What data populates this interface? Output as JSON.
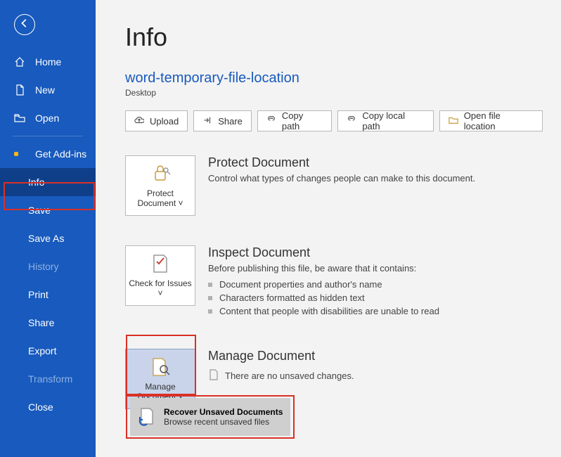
{
  "sidebar": {
    "items": [
      {
        "label": "Home"
      },
      {
        "label": "New"
      },
      {
        "label": "Open"
      },
      {
        "label": "Get Add-ins"
      },
      {
        "label": "Info"
      },
      {
        "label": "Save"
      },
      {
        "label": "Save As"
      },
      {
        "label": "History"
      },
      {
        "label": "Print"
      },
      {
        "label": "Share"
      },
      {
        "label": "Export"
      },
      {
        "label": "Transform"
      },
      {
        "label": "Close"
      }
    ]
  },
  "main": {
    "page_title": "Info",
    "doc_title": "word-temporary-file-location",
    "doc_location": "Desktop",
    "buttons": {
      "upload": "Upload",
      "share": "Share",
      "copy_path": "Copy path",
      "copy_local_path": "Copy local path",
      "open_file_location": "Open file location"
    },
    "protect": {
      "tile_label": "Protect Document",
      "title": "Protect Document",
      "desc": "Control what types of changes people can make to this document."
    },
    "inspect": {
      "tile_label": "Check for Issues",
      "title": "Inspect Document",
      "desc": "Before publishing this file, be aware that it contains:",
      "items": [
        "Document properties and author's name",
        "Characters formatted as hidden text",
        "Content that people with disabilities are unable to read"
      ]
    },
    "manage": {
      "tile_label": "Manage Document",
      "title": "Manage Document",
      "no_changes": "There are no unsaved changes."
    },
    "recover": {
      "title": "Recover Unsaved Documents",
      "sub": "Browse recent unsaved files"
    }
  },
  "colors": {
    "accent": "#185abd",
    "highlight": "#d93025",
    "tile_active_bg": "#c9d4ea"
  }
}
